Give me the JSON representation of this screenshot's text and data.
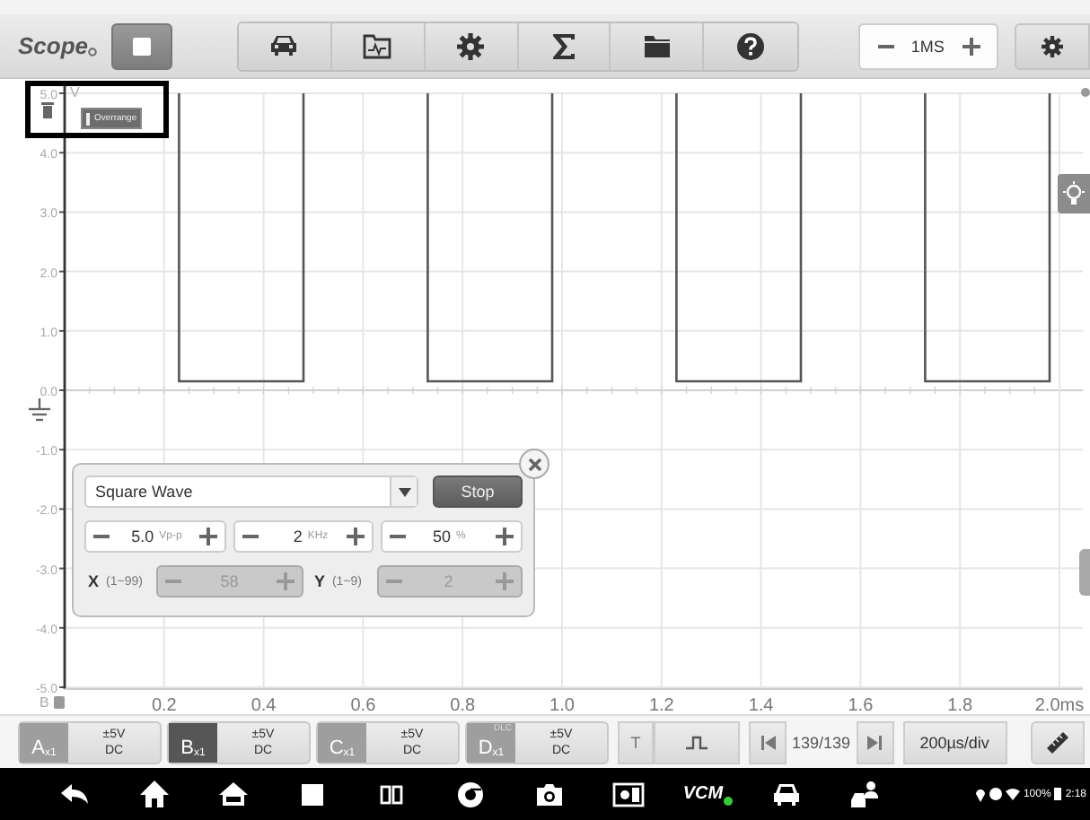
{
  "app": {
    "title": "Scope"
  },
  "toolbar": {
    "running": true,
    "timebase": "1MS"
  },
  "chart": {
    "unit": "V",
    "overrange_badge": "Overrange",
    "chart_data": {
      "type": "line",
      "grid": true,
      "x": [
        0.23,
        0.23,
        0.48,
        0.48,
        0.6,
        0.73,
        0.73,
        0.98,
        0.98,
        1.1,
        1.23,
        1.23,
        1.48,
        1.48,
        1.6,
        1.73,
        1.73,
        1.98,
        1.98
      ],
      "series": [
        {
          "name": "B",
          "color": "#555555",
          "values": [
            5,
            0.15,
            0.15,
            5,
            null,
            5,
            0.15,
            0.15,
            5,
            null,
            5,
            0.15,
            0.15,
            5,
            null,
            5,
            0.15,
            0.15,
            5
          ]
        }
      ],
      "xlim": [
        0,
        2
      ],
      "ylim": [
        -5,
        5
      ],
      "xticks": [
        0.2,
        0.4,
        0.6,
        0.8,
        {
          "value": 1.0,
          "label": "1.0"
        },
        1.2,
        1.4,
        1.6,
        1.8,
        {
          "value": 2.0,
          "label": "2.0ms"
        }
      ],
      "yticks": [
        {
          "value": 5,
          "label": "5.0"
        },
        {
          "value": 4,
          "label": "4.0"
        },
        {
          "value": 3,
          "label": "3.0"
        },
        {
          "value": 2,
          "label": "2.0"
        },
        {
          "value": 1,
          "label": "1.0"
        },
        {
          "value": 0,
          "label": "0.0"
        },
        {
          "value": -1,
          "label": "-1.0"
        },
        {
          "value": -2,
          "label": "-2.0"
        },
        {
          "value": -3,
          "label": "-3.0"
        },
        {
          "value": -4,
          "label": "-4.0"
        },
        {
          "value": -5,
          "label": "-5.0"
        }
      ]
    }
  },
  "generator": {
    "waveform": "Square Wave",
    "action": "Stop",
    "params": [
      {
        "value": "5.0",
        "unit": "Vp-p"
      },
      {
        "value": "2",
        "unit": "KHz"
      },
      {
        "value": "50",
        "unit": "%"
      }
    ],
    "position": [
      {
        "label": "X",
        "range": "(1~99)",
        "value": "58",
        "disabled": true
      },
      {
        "label": "Y",
        "range": "(1~9)",
        "value": "2",
        "disabled": true
      }
    ]
  },
  "channels": [
    {
      "label": "A$_{x1}$",
      "range": "±5V",
      "coupling": "DC",
      "selected": false
    },
    {
      "label": "B$_{x1}$",
      "range": "±5V",
      "coupling": "DC",
      "selected": true
    },
    {
      "label": "C$_{x1}$",
      "range": "±5V",
      "coupling": "DC",
      "selected": false
    },
    {
      "label": "D$_{x1}$",
      "tag": "DLC",
      "range": "±5V",
      "coupling": "DC",
      "selected": false
    }
  ],
  "trigger": {
    "label": "T"
  },
  "frames": {
    "counter": "139/139"
  },
  "timebase_div": "200µs/div",
  "nav": {
    "vcm_label": "VCM"
  },
  "status_bar": {
    "battery": "100%",
    "time": "2:18"
  }
}
